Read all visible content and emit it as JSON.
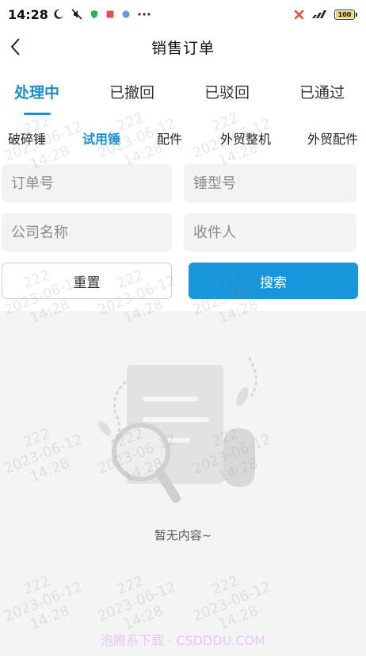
{
  "status_bar": {
    "time": "14:28",
    "battery": "100"
  },
  "nav": {
    "title": "销售订单"
  },
  "status_tabs": [
    {
      "label": "处理中",
      "active": true
    },
    {
      "label": "已撤回",
      "active": false
    },
    {
      "label": "已驳回",
      "active": false
    },
    {
      "label": "已通过",
      "active": false
    }
  ],
  "category_tabs": [
    {
      "label": "破碎锤",
      "active": false
    },
    {
      "label": "试用锤",
      "active": true
    },
    {
      "label": "配件",
      "active": false
    },
    {
      "label": "外贸整机",
      "active": false
    },
    {
      "label": "外贸配件",
      "active": false
    }
  ],
  "filters": {
    "order_no_placeholder": "订单号",
    "hammer_model_placeholder": "锤型号",
    "company_placeholder": "公司名称",
    "recipient_placeholder": "收件人"
  },
  "buttons": {
    "reset": "重置",
    "search": "搜索"
  },
  "empty_state": {
    "text": "暂无内容~"
  },
  "watermark": {
    "user": "222",
    "date": "2023-06-12",
    "time": "14:28"
  },
  "footer_watermark": "泡腾系下载 · CSDDDU.COM",
  "colors": {
    "accent": "#1a8fd0",
    "search_button": "#1796db"
  }
}
